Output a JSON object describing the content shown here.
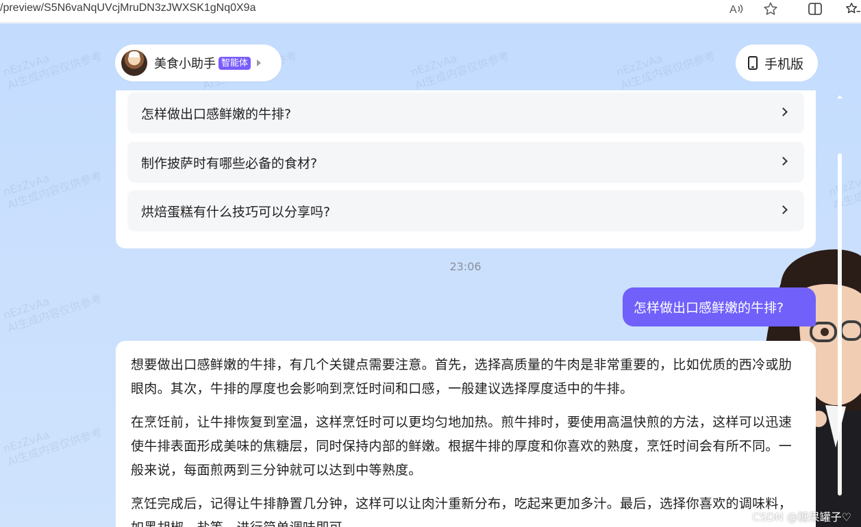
{
  "browser": {
    "url": "/preview/S5N6vaNqUVcjMruDN3zJWXSK1gNq0X9a",
    "read_aloud_icon": "read-aloud-icon",
    "favorite_icon": "star-icon",
    "split_icon": "split-screen-icon",
    "favorites_list_icon": "favorites-icon"
  },
  "agent": {
    "name": "美食小助手",
    "badge": "智能体"
  },
  "mobile_button": {
    "label": "手机版"
  },
  "suggestions": [
    {
      "text": "怎样做出口感鲜嫩的牛排?"
    },
    {
      "text": "制作披萨时有哪些必备的食材?"
    },
    {
      "text": "烘焙蛋糕有什么技巧可以分享吗?"
    }
  ],
  "chat": {
    "timestamp": "23:06",
    "user_message": "怎样做出口感鲜嫩的牛排?",
    "answer": [
      "想要做出口感鲜嫩的牛排，有几个关键点需要注意。首先，选择高质量的牛肉是非常重要的，比如优质的西冷或肋眼肉。其次，牛排的厚度也会影响到烹饪时间和口感，一般建议选择厚度适中的牛排。",
      "在烹饪前，让牛排恢复到室温，这样烹饪时可以更均匀地加热。煎牛排时，要使用高温快煎的方法，这样可以迅速使牛排表面形成美味的焦糖层，同时保持内部的鲜嫩。根据牛排的厚度和你喜欢的熟度，烹饪时间会有所不同。一般来说，每面煎两到三分钟就可以达到中等熟度。",
      "烹饪完成后，记得让牛排静置几分钟，这样可以让肉汁重新分布，吃起来更加多汁。最后，选择你喜欢的调味料，如黑胡椒、盐等，进行简单调味即可。"
    ]
  },
  "watermark": {
    "line1": "nEzZvAa",
    "line2": "AI生成内容仅供参考"
  },
  "footer_mark": "CSDN @糖果罐子♡",
  "colors": {
    "accent": "#7160fa",
    "badge": "#7a5cfa",
    "background": "#c3dcfe"
  }
}
